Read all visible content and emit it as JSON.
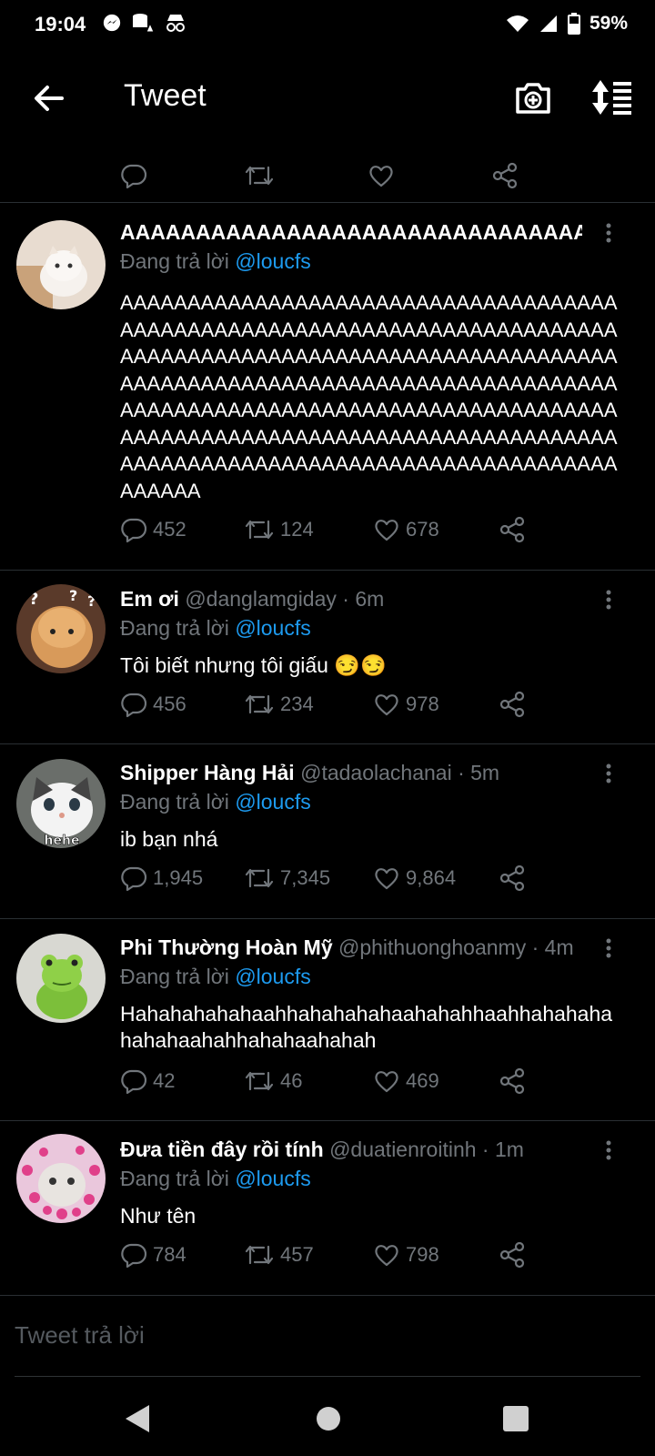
{
  "status_bar": {
    "time": "19:04",
    "battery": "59%"
  },
  "app_bar": {
    "title": "Tweet"
  },
  "top_actions": {},
  "tweets": [
    {
      "name": "AAAAAAAAAAAAAAAAAAAAAAAAAAAAAAAA...",
      "handle": "",
      "time": "",
      "reply_prefix": "Đang trả lời",
      "reply_to": "@loucfs",
      "text": "AAAAAAAAAAAAAAAAAAAAAAAAAAAAAAAAAAAAAAAAAAAAAAAAAAAAAAAAAAAAAAAAAAAAAAAAAAAAAAAAAAAAAAAAAAAAAAAAAAAAAAAAAAAAAAAAAAAAAAAAAAAAAAAAAAAAAAAAAAAAAAAAAAAAAAAAAAAAAAAAAAAAAAAAAAAAAAAAAAAAAAAAAAAAAAAAAAAAAAAAAAAAAAAAAAAAAAAAAAAAAAAAAAAAAAAAAAAAAAAAAAAAAAAAAAAAAAAAAAAAAAAAA",
      "replies": "452",
      "retweets": "124",
      "likes": "678"
    },
    {
      "name": "Em ơi",
      "handle": "@danglamgiday",
      "time": "· 6m",
      "reply_prefix": "Đang trả lời",
      "reply_to": "@loucfs",
      "text": "Tôi biết nhưng tôi giấu 😏😏",
      "replies": "456",
      "retweets": "234",
      "likes": "978"
    },
    {
      "name": "Shipper Hàng Hải",
      "handle": "@tadaolachanai",
      "time": "· 5m",
      "reply_prefix": "Đang trả lời",
      "reply_to": "@loucfs",
      "text": "ib bạn nhá",
      "avatar_caption": "hehe",
      "replies": "1,945",
      "retweets": "7,345",
      "likes": "9,864"
    },
    {
      "name": "Phi Thường Hoàn Mỹ",
      "handle": "@phithuonghoanmy",
      "time": "· 4m",
      "reply_prefix": "Đang trả lời",
      "reply_to": "@loucfs",
      "text": "Hahahahahahaahhahahahahaahahahhaahhahahahahahahaahahhahahaahahah",
      "replies": "42",
      "retweets": "46",
      "likes": "469"
    },
    {
      "name": "Đưa tiền đây rồi tính",
      "handle": "@duatienroitinh",
      "time": "· 1m",
      "reply_prefix": "Đang trả lời",
      "reply_to": "@loucfs",
      "text": "Như tên",
      "replies": "784",
      "retweets": "457",
      "likes": "798"
    }
  ],
  "composer": {
    "placeholder": "Tweet trả lời"
  },
  "colors": {
    "background": "#000000",
    "accent": "#1d9bf0",
    "muted": "#71767b",
    "divider": "#2a2f33"
  },
  "icons": [
    "back-arrow-icon",
    "camera-plus-icon",
    "sort-list-icon",
    "reply-icon",
    "retweet-icon",
    "like-icon",
    "share-icon",
    "more-vertical-icon"
  ]
}
